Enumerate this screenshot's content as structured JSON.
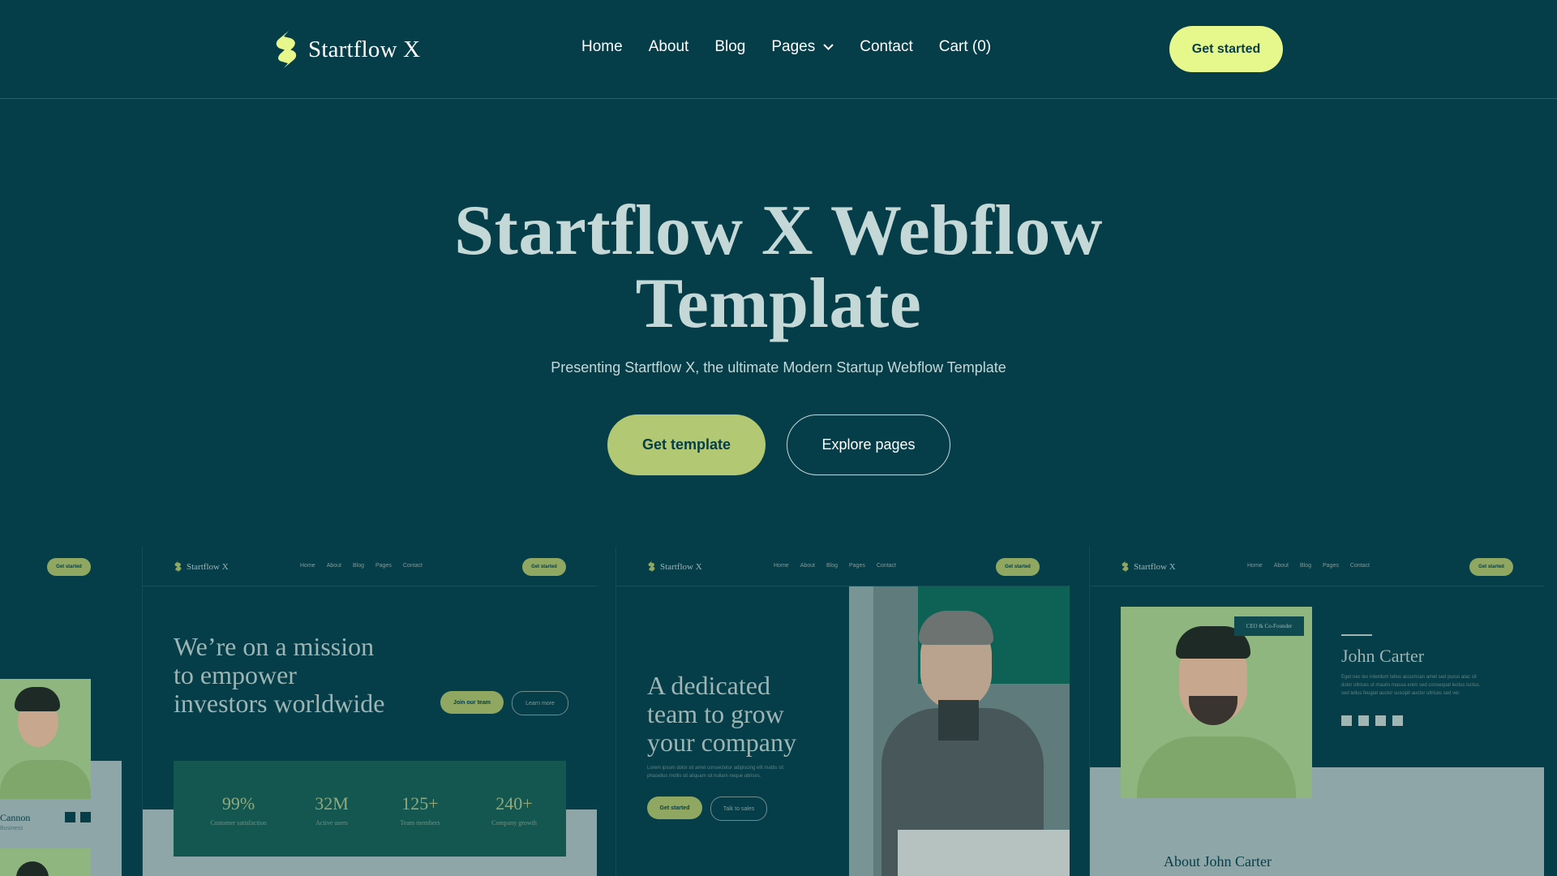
{
  "brand": {
    "name": "Startflow X",
    "logo_icon": "startflow-logo-icon"
  },
  "nav": {
    "items": [
      {
        "label": "Home"
      },
      {
        "label": "About"
      },
      {
        "label": "Blog"
      },
      {
        "label": "Pages"
      },
      {
        "label": "Contact"
      },
      {
        "label": "Cart (0)"
      }
    ],
    "cta": "Get started"
  },
  "hero": {
    "title_line1": "Startflow X Webflow",
    "title_line2": "Template",
    "subtitle": "Presenting Startflow X, the ultimate Modern Startup Webflow Template",
    "primary_cta": "Get template",
    "secondary_cta": "Explore pages"
  },
  "previews": {
    "partial": {
      "cta": "Get started",
      "name": "Cannon",
      "role": "Business"
    },
    "mission": {
      "brand": "Startflow X",
      "links": [
        "Home",
        "About",
        "Blog",
        "Pages",
        "Contact"
      ],
      "cta": "Get started",
      "title_lines": [
        "We’re on a mission",
        "to empower",
        "investors worldwide"
      ],
      "primary": "Join our team",
      "secondary": "Learn more",
      "stats": [
        {
          "value": "99%",
          "label": "Customer satisfaction"
        },
        {
          "value": "32M",
          "label": "Active users"
        },
        {
          "value": "125+",
          "label": "Team members"
        },
        {
          "value": "240+",
          "label": "Company growth"
        }
      ]
    },
    "team": {
      "brand": "Startflow X",
      "links": [
        "Home",
        "About",
        "Blog",
        "Pages",
        "Contact"
      ],
      "cta": "Get started",
      "title_lines": [
        "A dedicated",
        "team to grow",
        "your company"
      ],
      "body_line1": "Lorem ipsum dolor sit amet consectetur adipiscing elit mattis sit",
      "body_line2": "phasellus mollis sit aliquam sit nullam neque ultrices.",
      "primary": "Get started",
      "secondary": "Talk to sales"
    },
    "profile": {
      "brand": "Startflow X",
      "links": [
        "Home",
        "About",
        "Blog",
        "Pages",
        "Contact"
      ],
      "cta": "Get started",
      "badge": "CEO & Co-Founder",
      "name": "John Carter",
      "bio_line1": "Eget nec leo interdum tellus accumsan amet sed purus atac sit",
      "bio_line2": "dolor ultrices ut mauris massa enim sed consequat lectus luctus.",
      "bio_line3": "sed tellus feugiat auctor suscipit auctor ultrices sed vel.",
      "section_title": "About John Carter"
    }
  },
  "colors": {
    "background": "#053d48",
    "accent": "#e6f78c",
    "primary_button": "#b2c873",
    "text_muted": "#c5d8d8"
  }
}
